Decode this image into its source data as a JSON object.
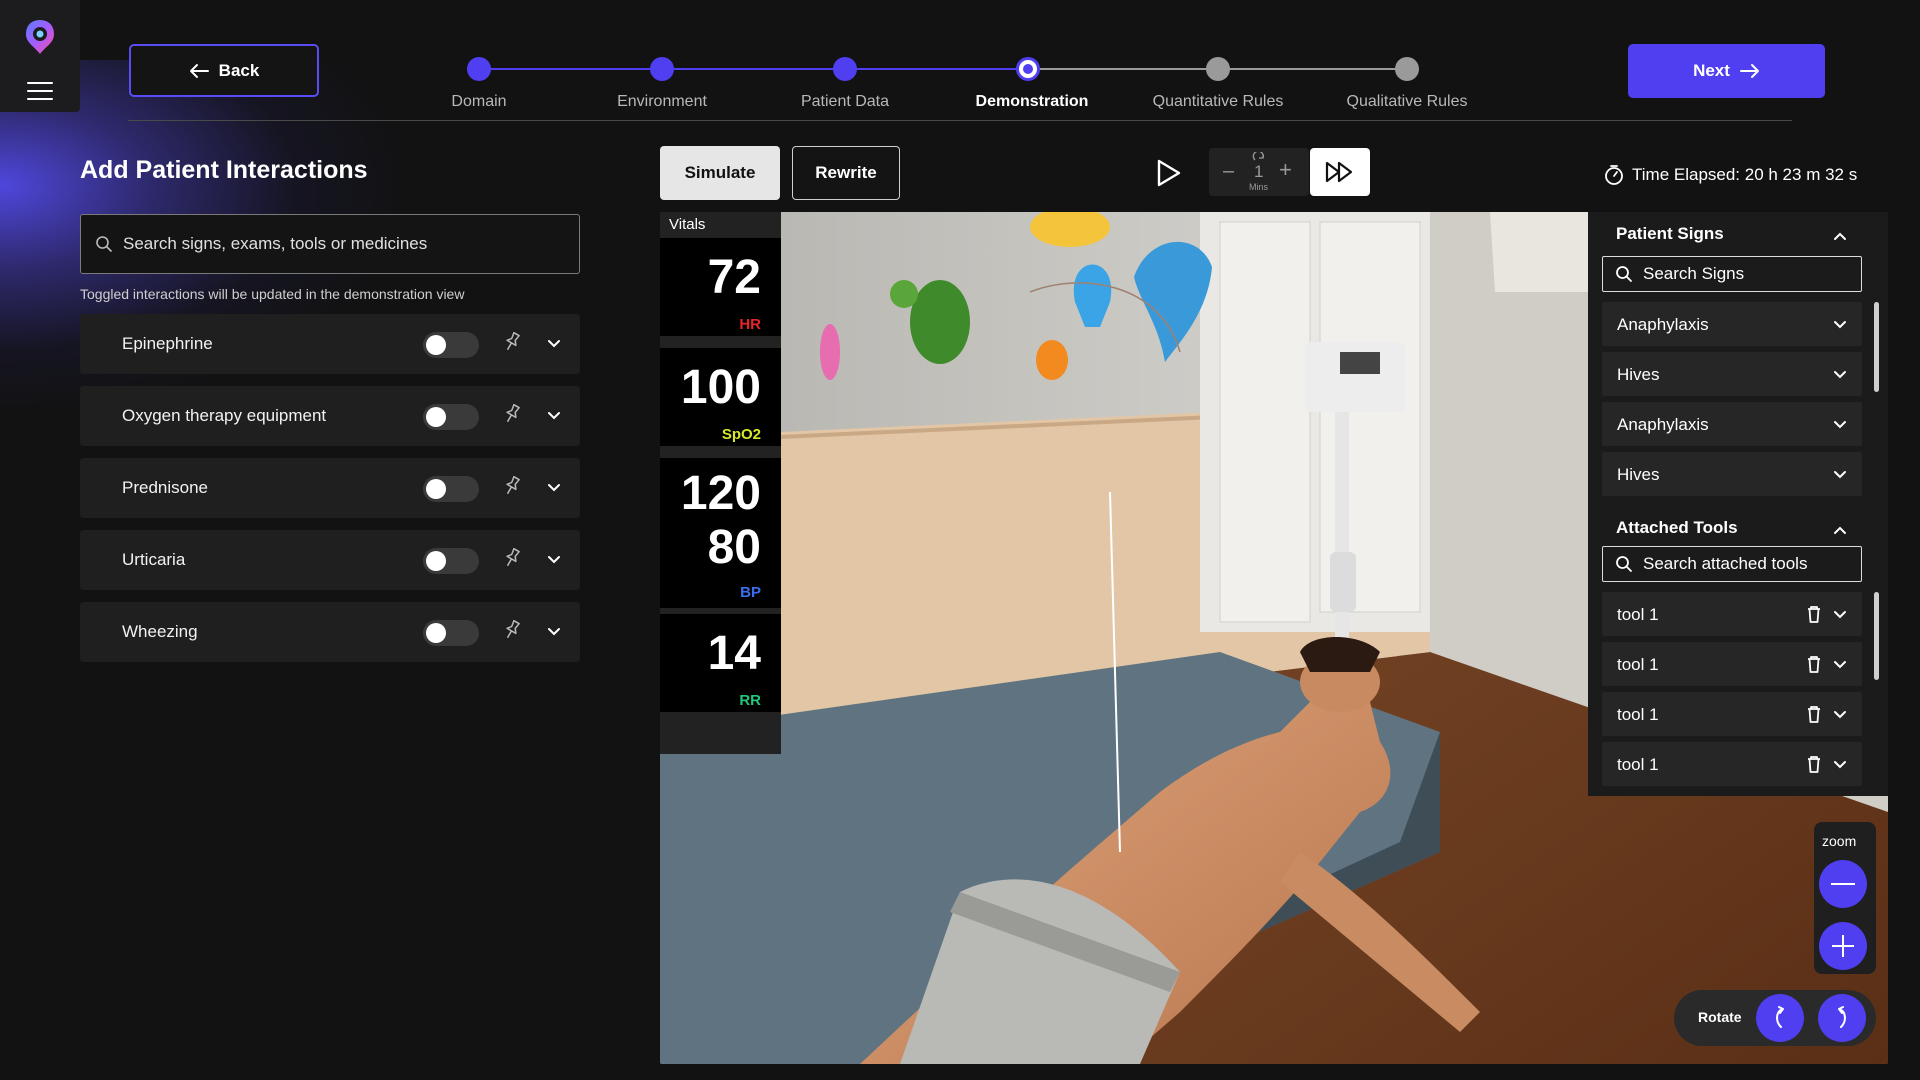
{
  "nav": {
    "back_label": "Back",
    "next_label": "Next",
    "steps": [
      {
        "label": "Domain",
        "state": "done"
      },
      {
        "label": "Environment",
        "state": "done"
      },
      {
        "label": "Patient Data",
        "state": "done"
      },
      {
        "label": "Demonstration",
        "state": "active"
      },
      {
        "label": "Quantitative Rules",
        "state": "todo"
      },
      {
        "label": "Qualitative Rules",
        "state": "todo"
      }
    ]
  },
  "left_panel": {
    "title": "Add Patient Interactions",
    "search_placeholder": "Search signs, exams, tools or medicines",
    "hint": "Toggled interactions will be updated in the demonstration view",
    "items": [
      {
        "label": "Epinephrine",
        "on": false
      },
      {
        "label": "Oxygen therapy equipment",
        "on": false
      },
      {
        "label": "Prednisone",
        "on": false
      },
      {
        "label": "Urticaria",
        "on": false
      },
      {
        "label": "Wheezing",
        "on": false
      }
    ]
  },
  "controls": {
    "simulate_label": "Simulate",
    "rewrite_label": "Rewrite",
    "speed_value": "1",
    "speed_unit": "Mins",
    "time_elapsed": "Time Elapsed: 20 h 23 m 32 s"
  },
  "vitals": {
    "title": "Vitals",
    "hr": {
      "value": "72",
      "label": "HR",
      "color": "#e5252a"
    },
    "spo2": {
      "value": "100",
      "label": "SpO2",
      "color": "#d8e82a"
    },
    "bp": {
      "systolic": "120",
      "diastolic": "80",
      "label": "BP",
      "color": "#3a6df0"
    },
    "rr": {
      "value": "14",
      "label": "RR",
      "color": "#22c77a"
    }
  },
  "side_panel": {
    "signs_title": "Patient Signs",
    "signs_search_placeholder": "Search Signs",
    "signs": [
      "Anaphylaxis",
      "Hives",
      "Anaphylaxis",
      "Hives"
    ],
    "tools_title": "Attached Tools",
    "tools_search_placeholder": "Search attached tools",
    "tools": [
      "tool 1",
      "tool 1",
      "tool 1",
      "tool 1"
    ]
  },
  "view_controls": {
    "zoom_label": "zoom",
    "rotate_label": "Rotate"
  },
  "colors": {
    "accent": "#4f3ff0",
    "background": "#121212",
    "panel": "#1f1f1f"
  }
}
